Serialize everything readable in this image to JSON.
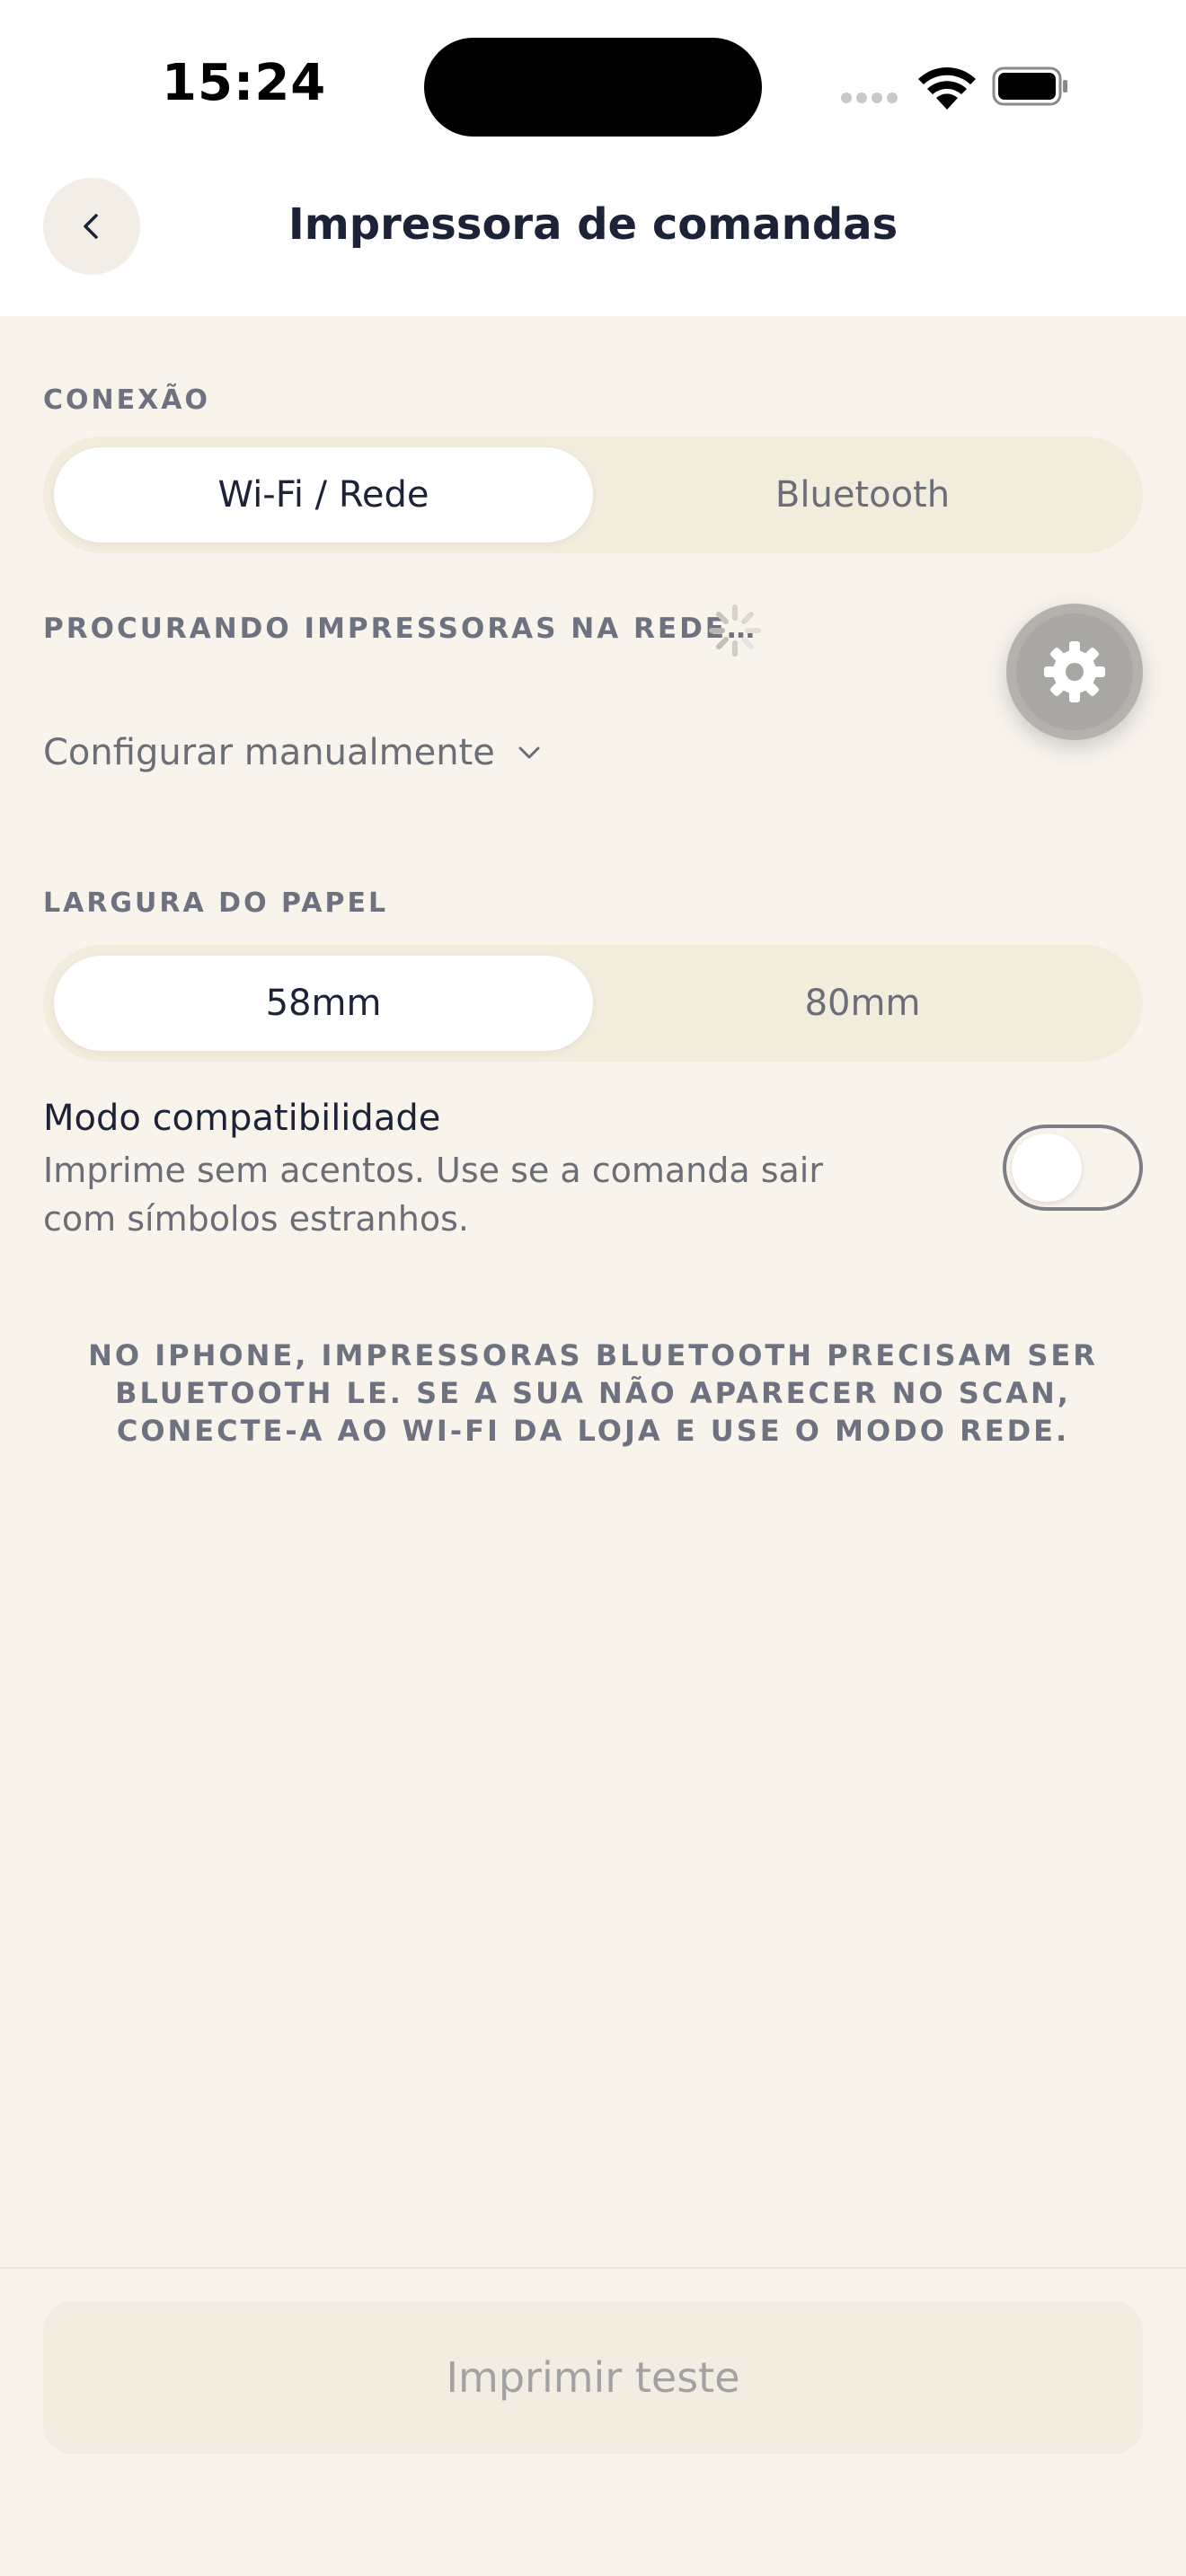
{
  "status_bar": {
    "time": "15:24",
    "signal_icon": "signal-dots-icon",
    "wifi_icon": "wifi-icon",
    "battery_icon": "battery-icon"
  },
  "header": {
    "back_icon": "chevron-left-icon",
    "title": "Impressora de comandas"
  },
  "connection": {
    "label": "CONEXÃO",
    "options": [
      "Wi-Fi / Rede",
      "Bluetooth"
    ],
    "selected": "Wi-Fi / Rede"
  },
  "scan": {
    "status": "PROCURANDO IMPRESSORAS NA REDE…",
    "spinner_icon": "loading-spinner-icon"
  },
  "fab": {
    "icon": "gear-icon"
  },
  "manual": {
    "label": "Configurar manualmente",
    "icon": "chevron-down-icon"
  },
  "paper": {
    "label": "LARGURA DO PAPEL",
    "options": [
      "58mm",
      "80mm"
    ],
    "selected": "58mm"
  },
  "compat": {
    "title": "Modo compatibilidade",
    "description": "Imprime sem acentos. Use se a comanda sair com símbolos estranhos.",
    "enabled": false
  },
  "notice": "NO IPHONE, IMPRESSORAS BLUETOOTH PRECISAM SER BLUETOOTH LE. SE A SUA NÃO APARECER NO SCAN, CONECTE-A AO WI-FI DA LOJA E USE O MODO REDE.",
  "print_button": {
    "label": "Imprimir teste",
    "disabled": true
  },
  "colors": {
    "background": "#f8f4ec",
    "header_bg": "#ffffff",
    "segment_bg": "#f2ecdd",
    "text_primary": "#1c2237",
    "text_secondary": "#6e7280"
  }
}
